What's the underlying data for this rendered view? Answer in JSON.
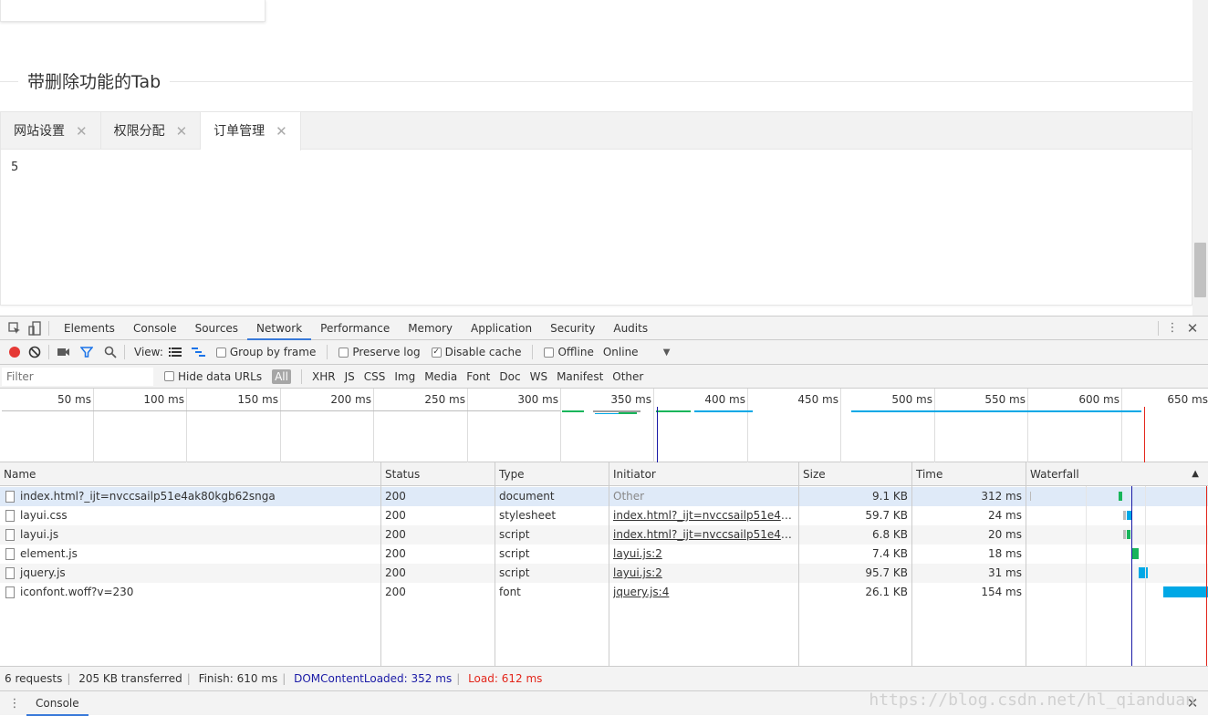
{
  "page": {
    "section_title": "带删除功能的Tab",
    "tabs": [
      {
        "label": "网站设置",
        "active": false
      },
      {
        "label": "权限分配",
        "active": false
      },
      {
        "label": "订单管理",
        "active": true
      }
    ],
    "tab_close_glyph": "✕",
    "tab_content": "5"
  },
  "devtools": {
    "panel_tabs": [
      "Elements",
      "Console",
      "Sources",
      "Network",
      "Performance",
      "Memory",
      "Application",
      "Security",
      "Audits"
    ],
    "active_panel": "Network",
    "toolbar": {
      "view_label": "View:",
      "group_by_frame": "Group by frame",
      "preserve_log": "Preserve log",
      "disable_cache": "Disable cache",
      "offline": "Offline",
      "throttle": "Online"
    },
    "filter": {
      "placeholder": "Filter",
      "hide_data_urls": "Hide data URLs",
      "types": [
        "All",
        "XHR",
        "JS",
        "CSS",
        "Img",
        "Media",
        "Font",
        "Doc",
        "WS",
        "Manifest",
        "Other"
      ]
    },
    "timeline_ticks": [
      "50 ms",
      "100 ms",
      "150 ms",
      "200 ms",
      "250 ms",
      "300 ms",
      "350 ms",
      "400 ms",
      "450 ms",
      "500 ms",
      "550 ms",
      "600 ms",
      "650 ms"
    ],
    "columns": [
      "Name",
      "Status",
      "Type",
      "Initiator",
      "Size",
      "Time",
      "Waterfall"
    ],
    "requests": [
      {
        "name": "index.html?_ijt=nvccsailp51e4ak80kgb62snga",
        "status": "200",
        "type": "document",
        "initiator": "Other",
        "size": "9.1 KB",
        "time": "312 ms"
      },
      {
        "name": "layui.css",
        "status": "200",
        "type": "stylesheet",
        "initiator": "index.html?_ijt=nvccsailp51e4ak80k...",
        "size": "59.7 KB",
        "time": "24 ms"
      },
      {
        "name": "layui.js",
        "status": "200",
        "type": "script",
        "initiator": "index.html?_ijt=nvccsailp51e4ak80k...",
        "size": "6.8 KB",
        "time": "20 ms"
      },
      {
        "name": "element.js",
        "status": "200",
        "type": "script",
        "initiator": "layui.js:2",
        "size": "7.4 KB",
        "time": "18 ms"
      },
      {
        "name": "jquery.js",
        "status": "200",
        "type": "script",
        "initiator": "layui.js:2",
        "size": "95.7 KB",
        "time": "31 ms"
      },
      {
        "name": "iconfont.woff?v=230",
        "status": "200",
        "type": "font",
        "initiator": "jquery.js:4",
        "size": "26.1 KB",
        "time": "154 ms"
      }
    ],
    "summary": {
      "requests": "6 requests",
      "transferred": "205 KB transferred",
      "finish": "Finish: 610 ms",
      "dom_content_loaded": "DOMContentLoaded: 352 ms",
      "load": "Load: 612 ms"
    },
    "drawer_tab": "Console",
    "colors": {
      "accent": "#3879d9",
      "record": "#e53935",
      "dom_loaded": "#1a1aa6",
      "load": "#e3261b",
      "waterfall_green": "#18b55b",
      "waterfall_blue": "#00a8e6"
    }
  },
  "watermark": "https://blog.csdn.net/hl_qianduan"
}
